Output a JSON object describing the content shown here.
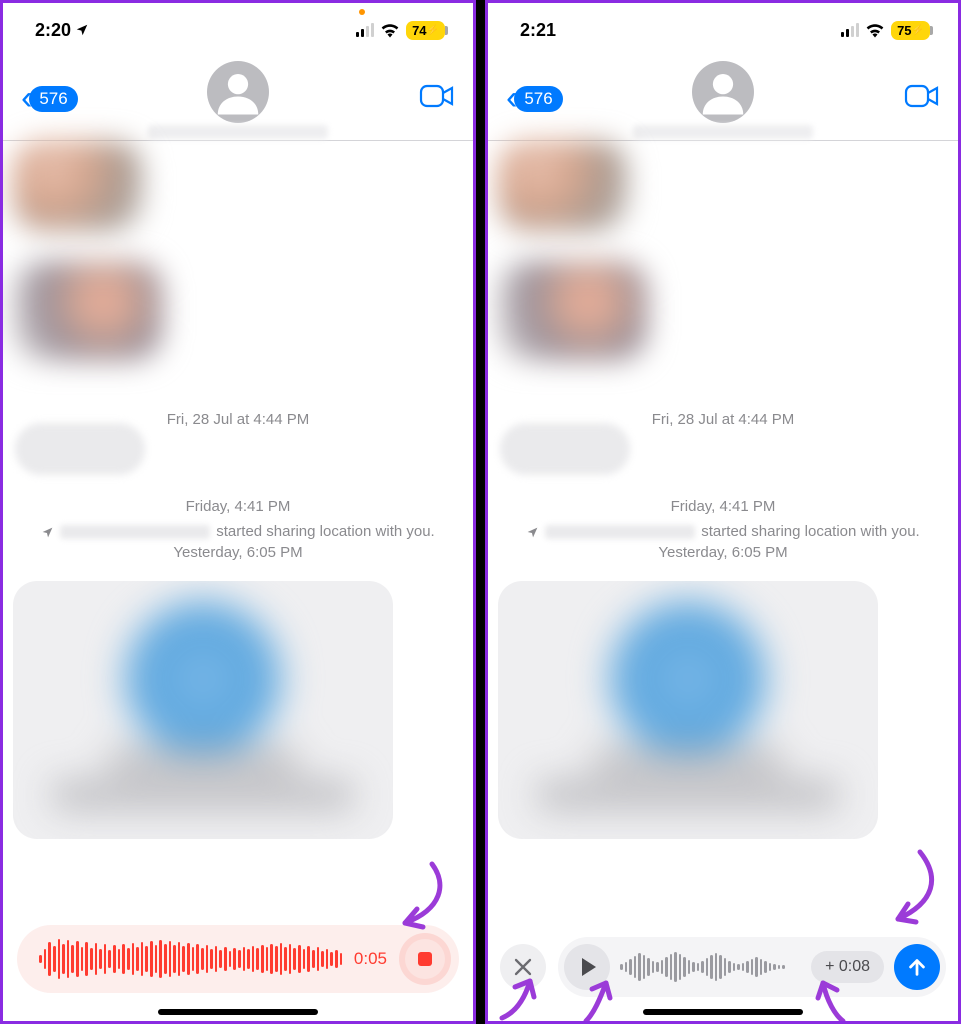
{
  "left": {
    "status": {
      "time": "2:20",
      "battery": "74"
    },
    "nav": {
      "back_count": "576"
    },
    "timeline": {
      "ts1_prefix": "Fri, 28 Jul",
      "ts1_at": " at ",
      "ts1_time": "4:44 PM",
      "ts2_prefix": "Friday,",
      "ts2_time": " 4:41 PM",
      "share_suffix": "started sharing location with you.",
      "ts3_prefix": "Yesterday,",
      "ts3_time": " 6:05 PM"
    },
    "recording": {
      "duration": "0:05"
    }
  },
  "right": {
    "status": {
      "time": "2:21",
      "battery": "75"
    },
    "nav": {
      "back_count": "576"
    },
    "timeline": {
      "ts1_prefix": "Fri, 28 Jul",
      "ts1_at": " at ",
      "ts1_time": "4:44 PM",
      "ts2_prefix": "Friday,",
      "ts2_time": " 4:41 PM",
      "share_suffix": "started sharing location with you.",
      "ts3_prefix": "Yesterday,",
      "ts3_time": " 6:05 PM"
    },
    "preview": {
      "duration_label": "+ 0:08"
    }
  }
}
